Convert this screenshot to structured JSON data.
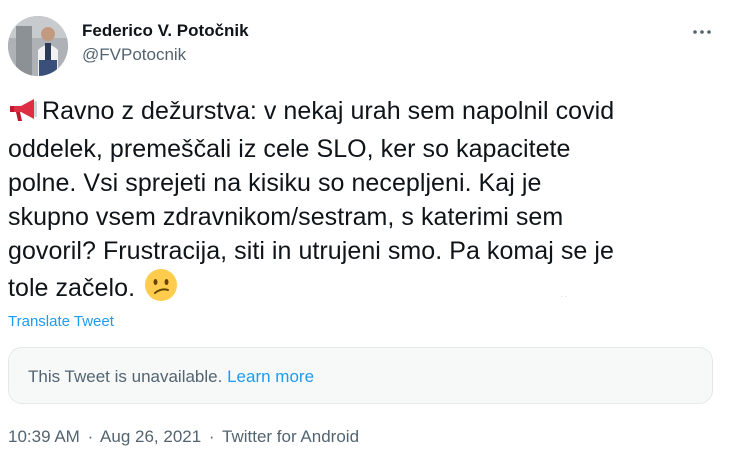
{
  "author": {
    "display_name": "Federico V. Potočnik",
    "handle": "@FVPotocnik"
  },
  "more_icon": "more-horizontal-icon",
  "tweet": {
    "text": "Ravno z dežurstva: v nekaj urah sem napolnil covid\noddelek, premeščali iz cele SLO, ker so kapacitete\npolne. Vsi sprejeti na kisiku so necepljeni. Kaj je\nskupno vsem zdravnikom/sestram, s katerimi sem\ngovoril? Frustracija, siti in utrujeni smo. Pa komaj se je\ntole začelo.",
    "lead_emoji": "megaphone-icon",
    "trail_emoji": "confused-face-icon"
  },
  "translate_label": "Translate Tweet",
  "quoted": {
    "unavailable_text": "This Tweet is unavailable.",
    "learn_more": "Learn more"
  },
  "meta": {
    "time": "10:39 AM",
    "date": "Aug 26, 2021",
    "source": "Twitter for Android",
    "separator": "·"
  },
  "colors": {
    "link": "#1d9bf0",
    "secondary_text": "#536471",
    "primary_text": "#0f1419",
    "card_bg": "#f7f9f9"
  }
}
